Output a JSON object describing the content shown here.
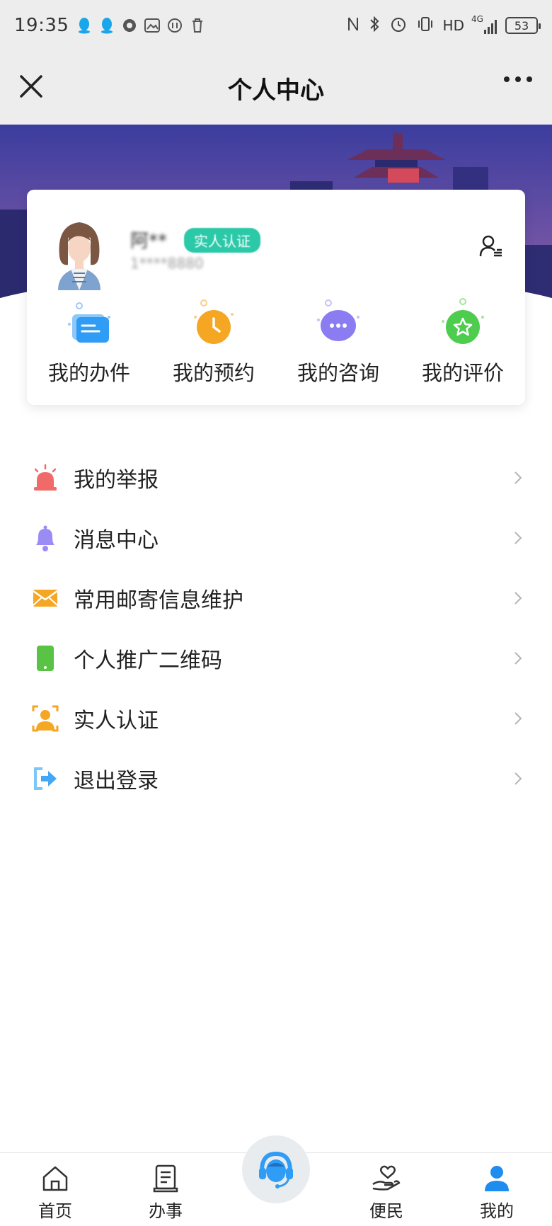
{
  "status_bar": {
    "time": "19:35",
    "network": "HD",
    "signal_label": "4G",
    "battery": "53"
  },
  "nav": {
    "title": "个人中心"
  },
  "profile": {
    "name": "阿**",
    "verify_badge": "实人认证",
    "phone": "1****8880"
  },
  "quick_actions": [
    {
      "label": "我的办件",
      "icon": "folder-icon",
      "color": "#2f9cf5"
    },
    {
      "label": "我的预约",
      "icon": "clock-icon",
      "color": "#f5a623"
    },
    {
      "label": "我的咨询",
      "icon": "chat-icon",
      "color": "#8b7cf2"
    },
    {
      "label": "我的评价",
      "icon": "star-icon",
      "color": "#4dcc4d"
    }
  ],
  "menu": [
    {
      "label": "我的举报",
      "icon": "siren-icon",
      "color": "#f06a6a"
    },
    {
      "label": "消息中心",
      "icon": "bell-icon",
      "color": "#9b8cf5"
    },
    {
      "label": "常用邮寄信息维护",
      "icon": "envelope-icon",
      "color": "#f5a623"
    },
    {
      "label": "个人推广二维码",
      "icon": "phone-icon",
      "color": "#59c346"
    },
    {
      "label": "实人认证",
      "icon": "face-id-icon",
      "color": "#f5a623"
    },
    {
      "label": "退出登录",
      "icon": "logout-icon",
      "color": "#43a7f5"
    }
  ],
  "tabs": [
    {
      "label": "首页",
      "icon": "home-icon"
    },
    {
      "label": "办事",
      "icon": "document-icon"
    },
    {
      "label": "",
      "icon": "customer-service-icon"
    },
    {
      "label": "便民",
      "icon": "heart-hand-icon"
    },
    {
      "label": "我的",
      "icon": "user-icon",
      "active": true
    }
  ],
  "colors": {
    "accent": "#1f8cf0",
    "badge": "#2cc9a9",
    "banner": "#3c3fa0"
  }
}
